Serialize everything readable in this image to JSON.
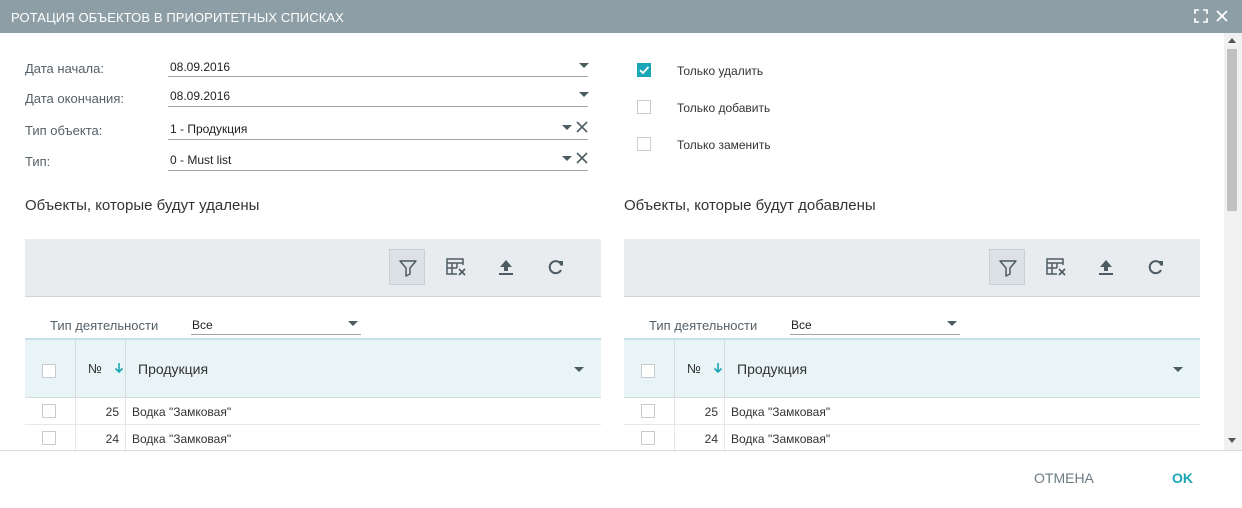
{
  "dialog": {
    "title": "РОТАЦИЯ ОБЪЕКТОВ В ПРИОРИТЕТНЫХ СПИСКАХ",
    "icons": [
      "maximize-icon",
      "close-icon"
    ]
  },
  "form": {
    "start_date_label": "Дата начала:",
    "start_date_value": "08.09.2016",
    "end_date_label": "Дата окончания:",
    "end_date_value": "08.09.2016",
    "object_type_label": "Тип объекта:",
    "object_type_value": "1 - Продукция",
    "type_label": "Тип:",
    "type_value": "0 - Must list"
  },
  "options": [
    {
      "label": "Только удалить",
      "checked": true
    },
    {
      "label": "Только добавить",
      "checked": false
    },
    {
      "label": "Только заменить",
      "checked": false
    }
  ],
  "left_panel": {
    "title": "Объекты, которые будут удалены",
    "activity_label": "Тип деятельности",
    "activity_value": "Все",
    "col_number": "№",
    "col_product": "Продукция",
    "rows": [
      {
        "num": "25",
        "name": "Водка \"Замковая\""
      },
      {
        "num": "24",
        "name": "Водка \"Замковая\""
      }
    ]
  },
  "right_panel": {
    "title": "Объекты, которые будут добавлены",
    "activity_label": "Тип деятельности",
    "activity_value": "Все",
    "col_number": "№",
    "col_product": "Продукция",
    "rows": [
      {
        "num": "25",
        "name": "Водка \"Замковая\""
      },
      {
        "num": "24",
        "name": "Водка \"Замковая\""
      }
    ]
  },
  "toolbar_icons": [
    "filter-icon",
    "clear-filter-grid-icon",
    "upload-icon",
    "refresh-icon"
  ],
  "footer": {
    "cancel_label": "ОТМЕНА",
    "ok_label": "OK"
  },
  "colors": {
    "titlebar": "#8d9ea6",
    "accent": "#1aa6b7",
    "grid_header": "#e8f4f6",
    "toolbar": "#e9ecee"
  }
}
